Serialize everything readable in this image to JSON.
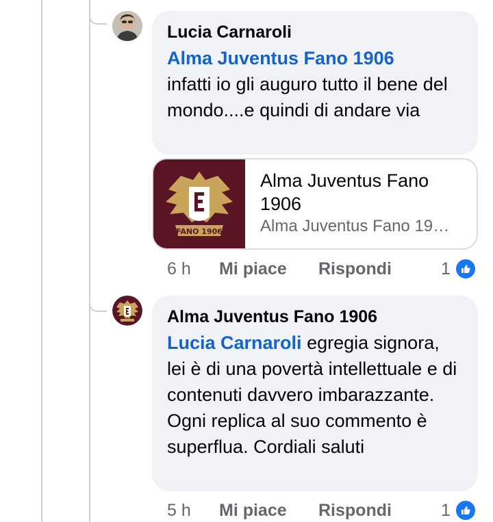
{
  "comments": [
    {
      "author": "Lucia Carnaroli",
      "mention": "Alma Juventus Fano 1906",
      "text": "infatti io gli auguro tutto il bene del mondo....e quindi di andare via",
      "link_preview": {
        "title": "Alma Juventus Fano 1906",
        "subtitle": "Alma Juventus Fano 19…",
        "logo_text": "FANO 1906"
      },
      "time": "6 h",
      "like_label": "Mi piace",
      "reply_label": "Rispondi",
      "reaction_count": "1"
    },
    {
      "author": "Alma Juventus Fano 1906",
      "mention": "Lucia Carnaroli",
      "text": "egregia signora, lei è di una povertà intellettuale e di contenuti davvero imbarazzante.  Ogni replica al suo commento è superflua. Cordiali saluti",
      "time": "5 h",
      "like_label": "Mi piace",
      "reply_label": "Rispondi",
      "reaction_count": "1"
    }
  ],
  "colors": {
    "bubble": "#f0f2f5",
    "mention": "#1463c8",
    "like_blue": "#1877f2",
    "club_maroon": "#5a1525",
    "club_gold": "#c9a45a"
  }
}
